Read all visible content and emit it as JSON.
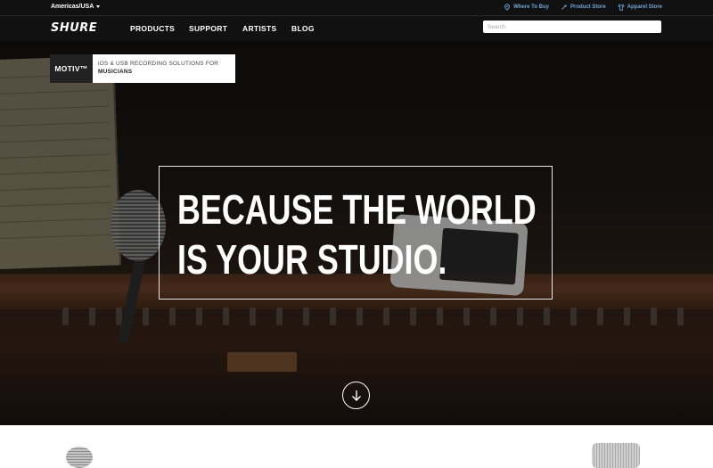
{
  "util_bar": {
    "region": "Americas/USA",
    "links": [
      {
        "label": "Where To Buy",
        "icon": "location-pin-icon"
      },
      {
        "label": "Product Store",
        "icon": "wrench-icon"
      },
      {
        "label": "Apparel Store",
        "icon": "shirt-icon"
      }
    ]
  },
  "nav": {
    "logo": "SHURE",
    "items": [
      "PRODUCTS",
      "SUPPORT",
      "ARTISTS",
      "BLOG"
    ],
    "search_placeholder": "Search"
  },
  "hero": {
    "brand": "MOTIV™",
    "tagline_line1": "iOS & USB RECORDING SOLUTIONS FOR",
    "tagline_line2": "MUSICIANS",
    "headline_line1": "BECAUSE THE WORLD",
    "headline_line2": "IS YOUR STUDIO.",
    "scroll_icon": "arrow-down-circle-icon"
  },
  "colors": {
    "bar_bg": "#111111",
    "util_link": "#6fa7d9"
  }
}
